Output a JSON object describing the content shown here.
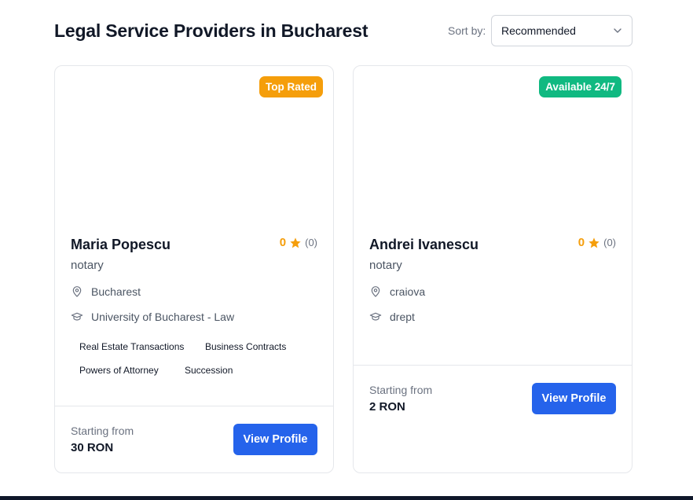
{
  "header": {
    "title": "Legal Service Providers in Bucharest",
    "sort_label": "Sort by:",
    "sort_value": "Recommended"
  },
  "providers": [
    {
      "badge": "Top Rated",
      "badge_color": "#f59e0b",
      "name": "Maria Popescu",
      "role": "notary",
      "rating": "0",
      "review_count": "(0)",
      "location": "Bucharest",
      "education": "University of Bucharest - Law",
      "tags": [
        "Real Estate Transactions",
        "Business Contracts",
        "Powers of Attorney",
        "Succession"
      ],
      "price_label": "Starting from",
      "price": "30 RON",
      "button_label": "View Profile"
    },
    {
      "badge": "Available 24/7",
      "badge_color": "#10b981",
      "name": "Andrei Ivanescu",
      "role": "notary",
      "rating": "0",
      "review_count": "(0)",
      "location": "craiova",
      "education": "drept",
      "tags": [],
      "price_label": "Starting from",
      "price": "2 RON",
      "button_label": "View Profile"
    }
  ],
  "colors": {
    "accent": "#2563eb",
    "star": "#f59e0b"
  }
}
